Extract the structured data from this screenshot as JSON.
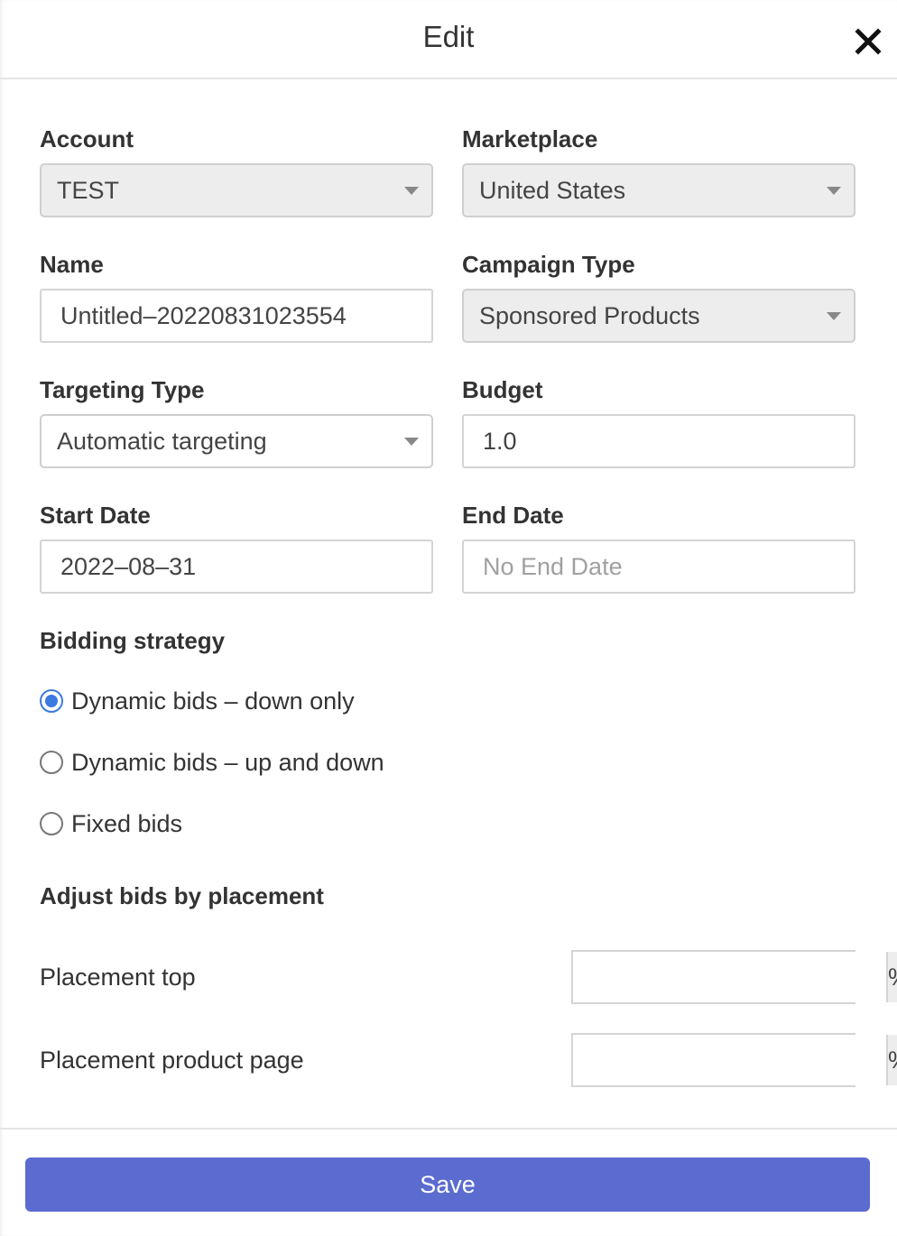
{
  "dialog": {
    "title": "Edit",
    "close_icon": "close-icon"
  },
  "form": {
    "account": {
      "label": "Account",
      "value": "TEST"
    },
    "marketplace": {
      "label": "Marketplace",
      "value": "United States"
    },
    "name": {
      "label": "Name",
      "value": "Untitled–20220831023554"
    },
    "campaign_type": {
      "label": "Campaign Type",
      "value": "Sponsored Products"
    },
    "targeting_type": {
      "label": "Targeting Type",
      "value": "Automatic targeting"
    },
    "budget": {
      "label": "Budget",
      "value": "1.0"
    },
    "start_date": {
      "label": "Start Date",
      "value": "2022–08–31"
    },
    "end_date": {
      "label": "End Date",
      "value": "",
      "placeholder": "No End Date"
    }
  },
  "bidding": {
    "label": "Bidding strategy",
    "options": [
      {
        "label": "Dynamic bids – down only",
        "checked": true
      },
      {
        "label": "Dynamic bids – up and down",
        "checked": false
      },
      {
        "label": "Fixed bids",
        "checked": false
      }
    ]
  },
  "placement": {
    "label": "Adjust bids by placement",
    "rows": [
      {
        "label": "Placement top",
        "value": "",
        "unit": "%"
      },
      {
        "label": "Placement product page",
        "value": "",
        "unit": "%"
      }
    ]
  },
  "footer": {
    "save_label": "Save"
  },
  "colors": {
    "accent": "#3b7ae0",
    "save_button": "#5b6bcf"
  }
}
